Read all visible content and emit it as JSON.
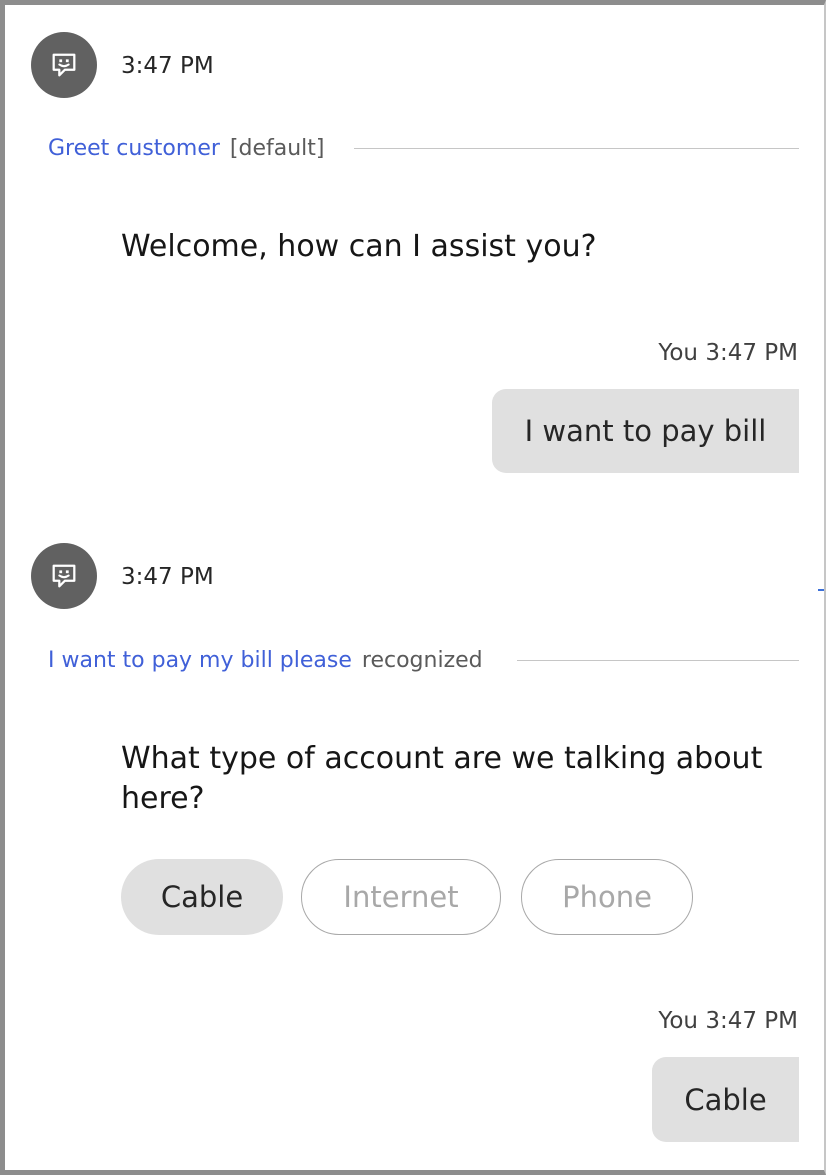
{
  "messages": [
    {
      "time": "3:47 PM",
      "intent_link": "Greet customer",
      "intent_tag": "[default]",
      "text": "Welcome, how can I assist you?"
    },
    {
      "time": "3:47 PM",
      "intent_link": "I want to pay my bill please",
      "intent_tag": "recognized",
      "text": "What type of account are we talking about here?"
    }
  ],
  "user_messages": [
    {
      "meta": "You 3:47 PM",
      "text": "I want to pay bill"
    },
    {
      "meta": "You 3:47 PM",
      "text": "Cable"
    }
  ],
  "options": [
    {
      "label": "Cable",
      "selected": true
    },
    {
      "label": "Internet",
      "selected": false
    },
    {
      "label": "Phone",
      "selected": false
    }
  ],
  "colors": {
    "intent_link": "#4060d8",
    "avatar": "#616161",
    "bubble": "#e0e0e0"
  },
  "icons": {
    "bot_avatar": "chatbot-face-icon"
  }
}
